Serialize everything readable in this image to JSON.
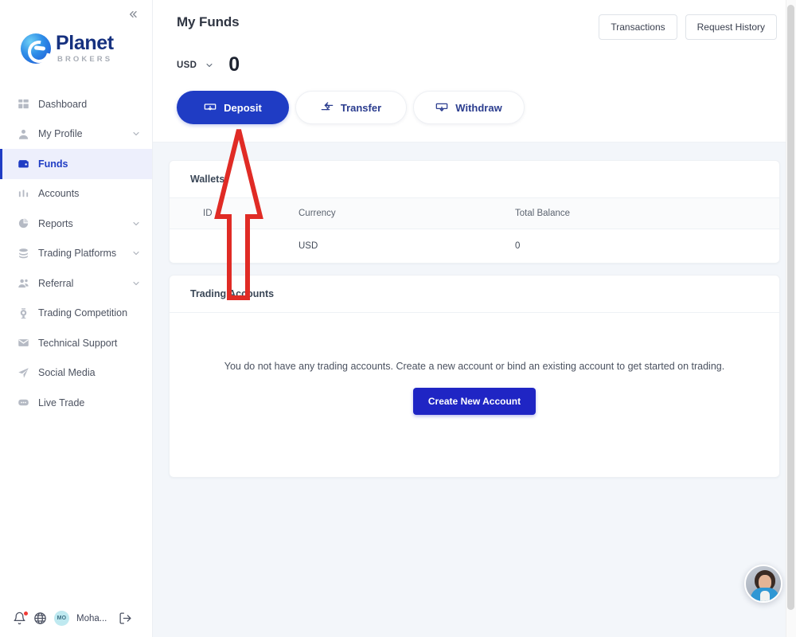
{
  "sidebar": {
    "collapse_icon": "chevron-double-left-icon",
    "logo": {
      "name": "Planet",
      "subtitle": "BROKERS",
      "mark": "e-globe-icon"
    },
    "items": [
      {
        "label": "Dashboard",
        "icon": "grid-icon",
        "expandable": false,
        "active": false
      },
      {
        "label": "My Profile",
        "icon": "user-icon",
        "expandable": true,
        "active": false
      },
      {
        "label": "Funds",
        "icon": "wallet-icon",
        "expandable": false,
        "active": true
      },
      {
        "label": "Accounts",
        "icon": "bars-icon",
        "expandable": false,
        "active": false
      },
      {
        "label": "Reports",
        "icon": "pie-chart-icon",
        "expandable": true,
        "active": false
      },
      {
        "label": "Trading Platforms",
        "icon": "database-icon",
        "expandable": true,
        "active": false
      },
      {
        "label": "Referral",
        "icon": "users-icon",
        "expandable": true,
        "active": false
      },
      {
        "label": "Trading Competition",
        "icon": "trophy-icon",
        "expandable": false,
        "active": false
      },
      {
        "label": "Technical Support",
        "icon": "envelope-icon",
        "expandable": false,
        "active": false
      },
      {
        "label": "Social Media",
        "icon": "send-icon",
        "expandable": false,
        "active": false
      },
      {
        "label": "Live Trade",
        "icon": "chat-icon",
        "expandable": false,
        "active": false
      }
    ],
    "footer": {
      "bell_icon": "bell-icon",
      "has_notification": true,
      "globe_icon": "globe-icon",
      "avatar_initials": "MO",
      "user_name": "Moha...",
      "logout_icon": "logout-icon"
    }
  },
  "header": {
    "title": "My Funds",
    "transactions_label": "Transactions",
    "request_history_label": "Request History",
    "currency": "USD",
    "currency_chevron": "chevron-down-icon",
    "balance": "0",
    "actions": [
      {
        "label": "Deposit",
        "icon": "deposit-card-icon",
        "style": "primary"
      },
      {
        "label": "Transfer",
        "icon": "transfer-arrows-icon",
        "style": "secondary"
      },
      {
        "label": "Withdraw",
        "icon": "withdraw-card-icon",
        "style": "secondary"
      }
    ]
  },
  "wallets": {
    "title": "Wallets",
    "columns": [
      "ID",
      "Currency",
      "Total Balance"
    ],
    "rows": [
      {
        "id": "",
        "currency": "USD",
        "total_balance": "0"
      }
    ]
  },
  "trading_accounts": {
    "title": "Trading Accounts",
    "empty_message": "You do not have any trading accounts. Create a new account or bind an existing account to get started on trading.",
    "create_button_label": "Create New Account"
  },
  "chat_widget": {
    "name": "support-agent-avatar"
  },
  "annotation": {
    "type": "arrow",
    "color": "#e02b25",
    "points_to": "Deposit"
  },
  "colors": {
    "accent": "#1f3cc4",
    "create_button": "#1f25c4",
    "active_nav_bg": "#edeffc",
    "page_bg": "#f3f6fa",
    "annotation_red": "#e02b25"
  }
}
